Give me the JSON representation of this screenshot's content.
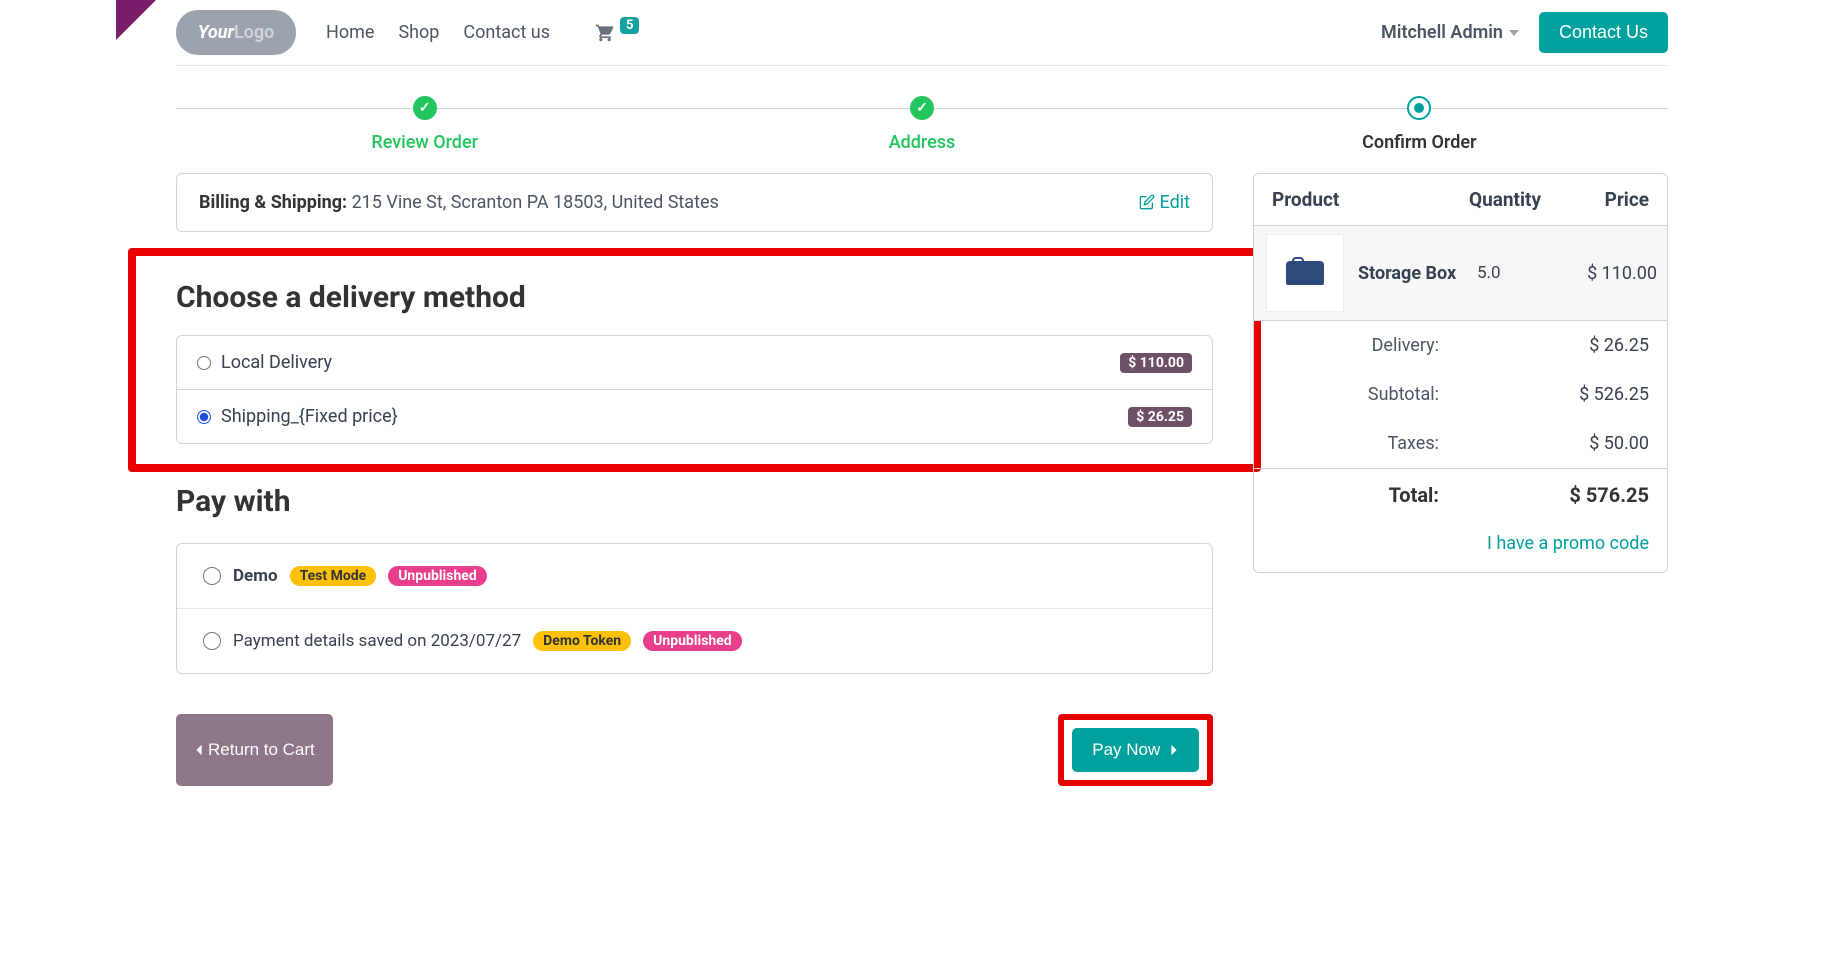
{
  "nav": {
    "home": "Home",
    "shop": "Shop",
    "contact": "Contact us",
    "cart_count": "5"
  },
  "user_name": "Mitchell Admin",
  "contact_btn": "Contact Us",
  "wizard": {
    "review": "Review Order",
    "address": "Address",
    "confirm": "Confirm Order"
  },
  "address": {
    "label": "Billing & Shipping:",
    "text": "215 Vine St, Scranton PA 18503, United States",
    "edit": "Edit"
  },
  "delivery": {
    "heading": "Choose a delivery method",
    "options": [
      {
        "label": "Local Delivery",
        "price": "$ 110.00",
        "selected": false
      },
      {
        "label": "Shipping_{Fixed price}",
        "price": "$ 26.25",
        "selected": true
      }
    ]
  },
  "pay": {
    "heading": "Pay with",
    "options": [
      {
        "label": "Demo",
        "badges": [
          {
            "text": "Test Mode",
            "type": "yellow"
          },
          {
            "text": "Unpublished",
            "type": "red"
          }
        ]
      },
      {
        "label": "Payment details saved on 2023/07/27",
        "badges": [
          {
            "text": "Demo Token",
            "type": "yellow"
          },
          {
            "text": "Unpublished",
            "type": "red"
          }
        ]
      }
    ]
  },
  "actions": {
    "back": "Return to Cart",
    "pay": "Pay Now"
  },
  "summary": {
    "cols": {
      "product": "Product",
      "qty": "Quantity",
      "price": "Price"
    },
    "item": {
      "name": "Storage Box",
      "qty": "5.0",
      "price": "$ 110.00"
    },
    "delivery_label": "Delivery:",
    "delivery_val": "$ 26.25",
    "subtotal_label": "Subtotal:",
    "subtotal_val": "$ 526.25",
    "taxes_label": "Taxes:",
    "taxes_val": "$ 50.00",
    "total_label": "Total:",
    "total_val": "$ 576.25",
    "promo": "I have a promo code"
  }
}
